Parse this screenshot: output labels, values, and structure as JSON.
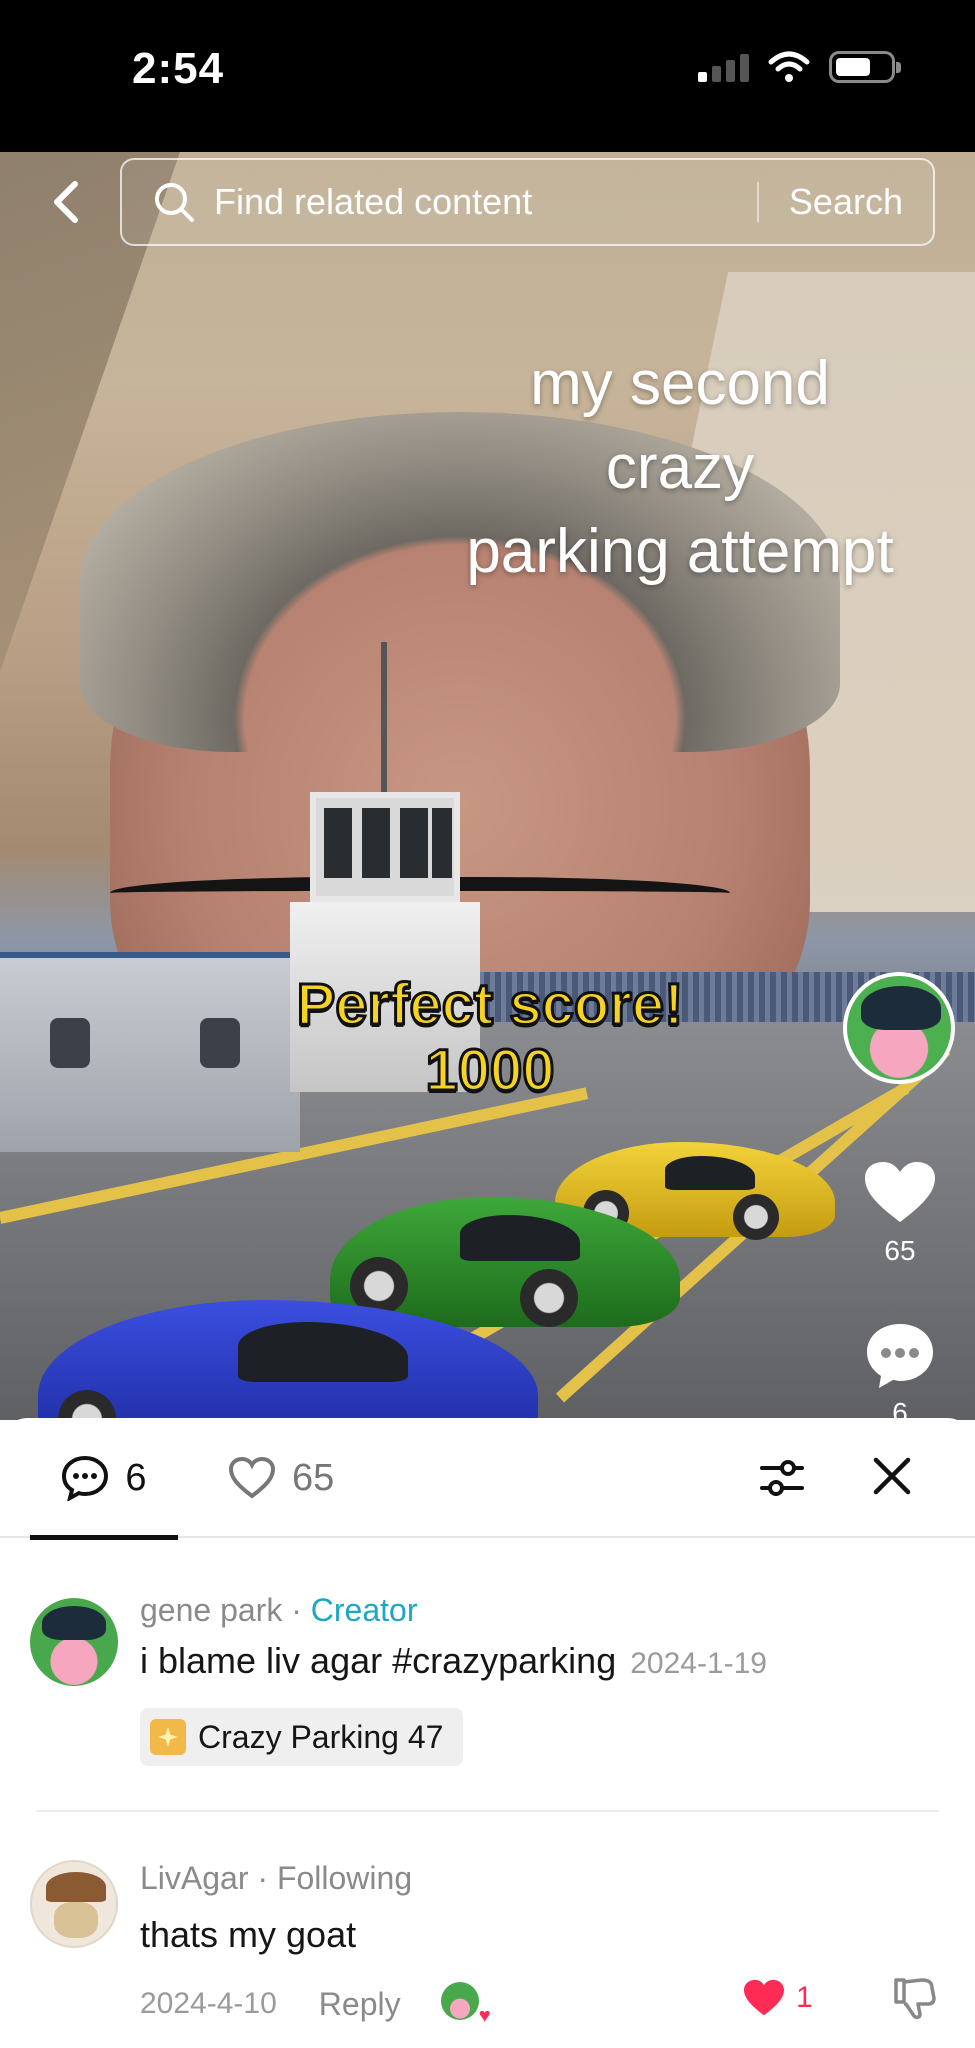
{
  "status_bar": {
    "time": "2:54"
  },
  "search": {
    "placeholder": "Find related content",
    "button_label": "Search"
  },
  "video": {
    "caption_lines": [
      "my second",
      "crazy",
      "parking attempt"
    ],
    "score_label": "Perfect score!",
    "score_value": "1000",
    "like_count": "65",
    "comment_count": "6"
  },
  "sheet": {
    "tabs": {
      "comments_count": "6",
      "likes_count": "65"
    },
    "comments": [
      {
        "author": "gene  park",
        "author_tag": "Creator",
        "text": "i blame liv agar #crazyparking",
        "date": "2024-1-19",
        "game_chip": "Crazy Parking 47"
      },
      {
        "author": "LivAgar",
        "author_tag": "Following",
        "text": "thats my goat",
        "date": "2024-4-10",
        "reply_label": "Reply",
        "like_count": "1"
      }
    ]
  },
  "colors": {
    "accent_red": "#fe2c55",
    "creator_tag": "#1aa8c2",
    "score_yellow": "#f5d322"
  }
}
